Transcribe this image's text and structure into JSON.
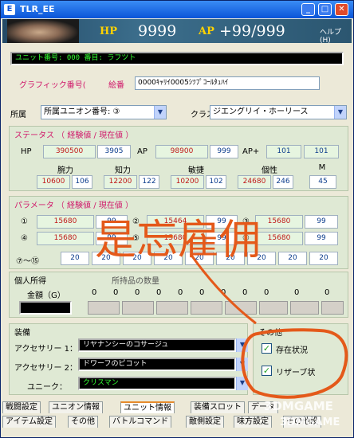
{
  "window": {
    "title": "TLR_EE",
    "icon": "E"
  },
  "banner": {
    "hp_label": "HP",
    "hp_value": "9999",
    "ap_label": "AP",
    "ap_value": "+99/999",
    "help": "ヘルプ(H)"
  },
  "unit_number_box": "ユニット番号: 000 番目: ラフツト",
  "graphic": {
    "label": "グラフィック番号(",
    "label2": "絵番",
    "value": "0000ｷｬﾘｲ0005ｼﾂﾌﾟｺｰﾙﾀｭﾊｲ"
  },
  "affiliation": {
    "label": "所属",
    "value": "所属ユニオン番号: ③",
    "class_label": "クラス",
    "class_value": "ジエングリイ・ホーリース"
  },
  "status": {
    "title": "ステータス （ 経験値 / 現在値 ）",
    "hp_label": "HP",
    "hp_exp": "390500",
    "hp_cur": "3905",
    "ap_label": "AP",
    "ap_exp": "98900",
    "ap_cur": "999",
    "app_label": "AP+",
    "app_exp": "101",
    "app_cur": "101",
    "headers": [
      "腕力",
      "知力",
      "敏捷",
      "個性",
      "M"
    ],
    "values": [
      [
        "10600",
        "106"
      ],
      [
        "12200",
        "122"
      ],
      [
        "10200",
        "102"
      ],
      [
        "24680",
        "246"
      ],
      [
        "45"
      ]
    ]
  },
  "params": {
    "title": "パラメータ （ 経験値 / 現在値 ）",
    "row1": {
      "label": "①",
      "a": "15680",
      "b": "99",
      "label2": "②",
      "c": "15464",
      "d": "99",
      "label3": "③",
      "e": "15680",
      "f": "99"
    },
    "row2": {
      "label": "④",
      "a": "15680",
      "b": "99",
      "label2": "⑤",
      "c": "15680",
      "d": "99",
      "label3": "⑥",
      "e": "15680",
      "f": "99"
    },
    "row3": {
      "label": "⑦〜⑮",
      "values": [
        "20",
        "20",
        "20",
        "20",
        "20",
        "20",
        "20",
        "20",
        "20"
      ]
    }
  },
  "personal": {
    "title": "個人所得",
    "title2": "所持品の数量",
    "money_label": "金額（G）",
    "counts": [
      "0",
      "0",
      "0",
      "0",
      "0",
      "0",
      "0",
      "0",
      "0",
      "0",
      "0"
    ]
  },
  "equip": {
    "title": "装備",
    "acc1_label": "アクセサリー 1：",
    "acc1_value": "リヤナンシーのコサージュ",
    "acc2_label": "アクセサリー 2：",
    "acc2_value": "ドワーフのピコット",
    "unique_label": "ユニーク：",
    "unique_value": "クリスマン"
  },
  "other": {
    "title": "その他",
    "exists": "存在状況",
    "reserve": "リザーブ状",
    "exists_checked": true,
    "reserve_checked": true
  },
  "tabs_row1": [
    "戦闘設定",
    "ユニオン情報",
    "ユニット情報",
    "装備スロット",
    "データ"
  ],
  "tabs_row2": [
    "アイテム設定",
    "その他",
    "バトルコマンド",
    "敵側設定",
    "味方設定",
    "その他設"
  ],
  "annotation": {
    "text": "是忘雇佣",
    "color": "#e4591a"
  },
  "watermark": {
    "top": "3DMGAME",
    "bottom": "3DMGAME"
  }
}
